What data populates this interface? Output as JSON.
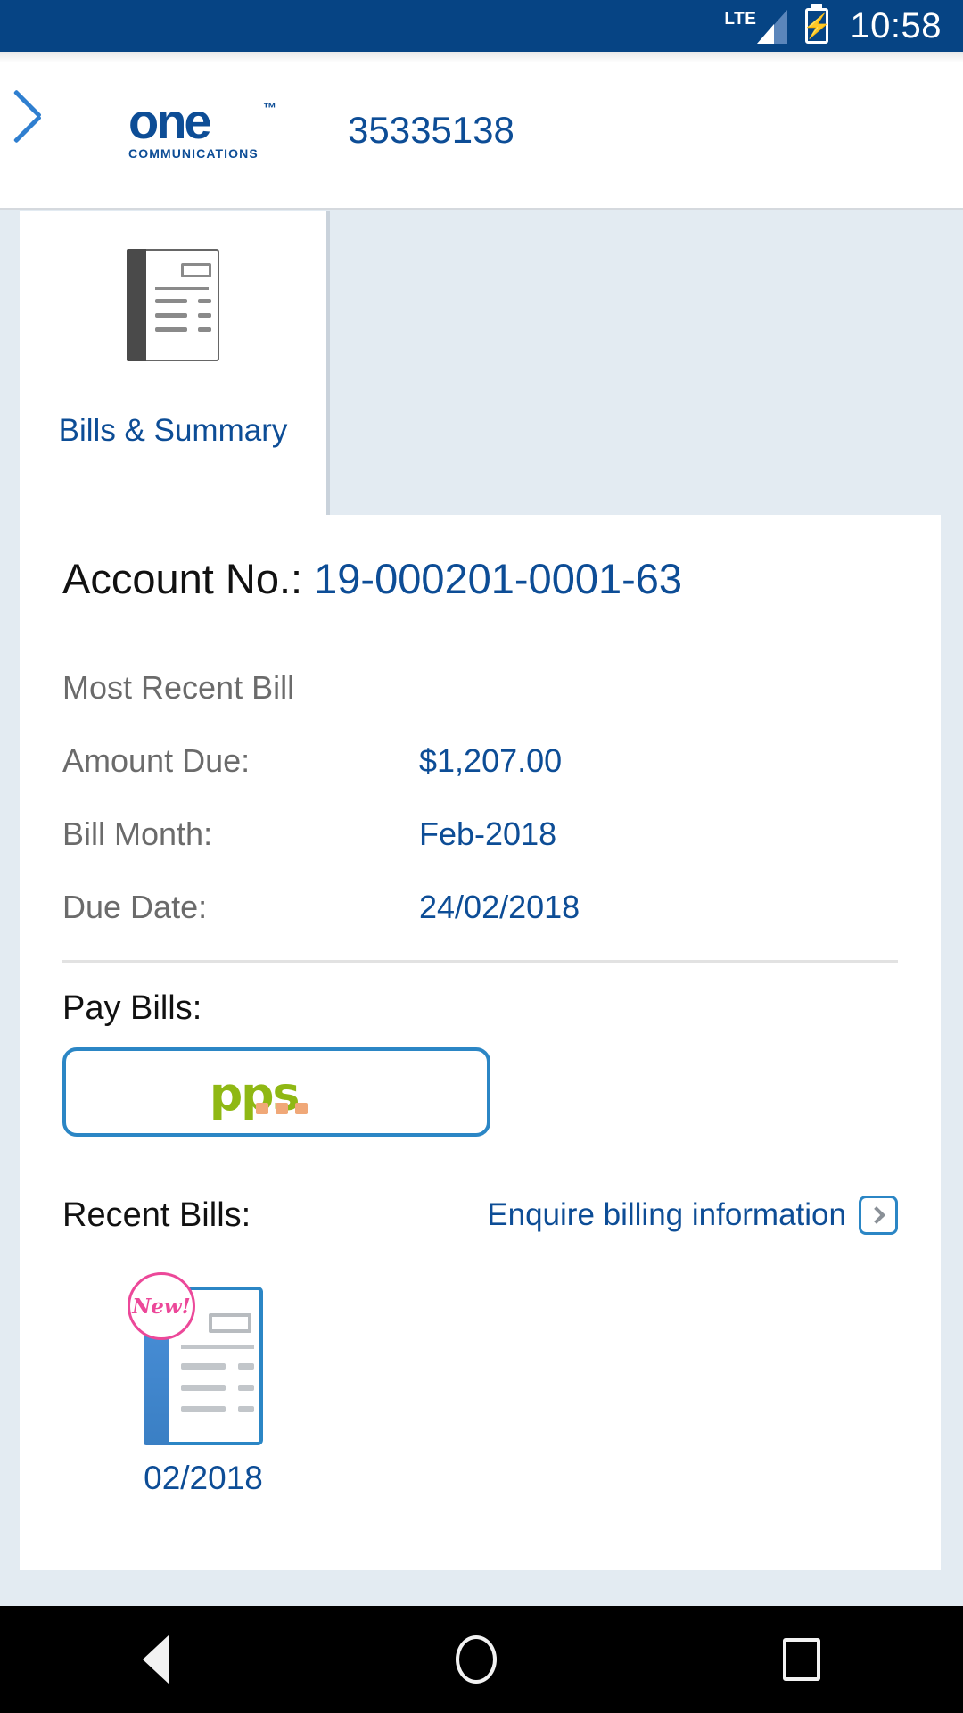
{
  "status_bar": {
    "network_label": "LTE",
    "signal_icon": "signal-bars-icon",
    "battery_icon": "battery-charging-icon",
    "time": "10:58",
    "background_color": "#064484"
  },
  "app_bar": {
    "back_icon": "chevron-left-icon",
    "logo_main": "one",
    "logo_trademark": "™",
    "logo_sub": "COMMUNICATIONS",
    "phone_number": "35335138",
    "brand_color": "#0d4d96"
  },
  "tabs": [
    {
      "label": "Bills & Summary",
      "icon": "document-bill-icon",
      "active": true
    }
  ],
  "account": {
    "label": "Account No.: ",
    "value": "19-000201-0001-63"
  },
  "most_recent_bill": {
    "title": "Most Recent Bill",
    "rows": [
      {
        "label": "Amount Due:",
        "value": "$1,207.00"
      },
      {
        "label": "Bill Month:",
        "value": "Feb-2018"
      },
      {
        "label": "Due Date:",
        "value": "24/02/2018"
      }
    ]
  },
  "pay_bills": {
    "title": "Pay Bills:",
    "button_logo": "pps-logo",
    "button_logo_text": "pps",
    "border_color": "#2b86c5"
  },
  "recent_bills": {
    "title": "Recent Bills:",
    "enquire_label": "Enquire billing information",
    "enquire_icon": "chevron-right-box-icon",
    "items": [
      {
        "date": "02/2018",
        "badge": "New!",
        "icon": "document-bill-blue-icon"
      }
    ]
  },
  "nav_bar": {
    "back_icon": "triangle-back-icon",
    "home_icon": "circle-home-icon",
    "recents_icon": "square-recents-icon"
  }
}
